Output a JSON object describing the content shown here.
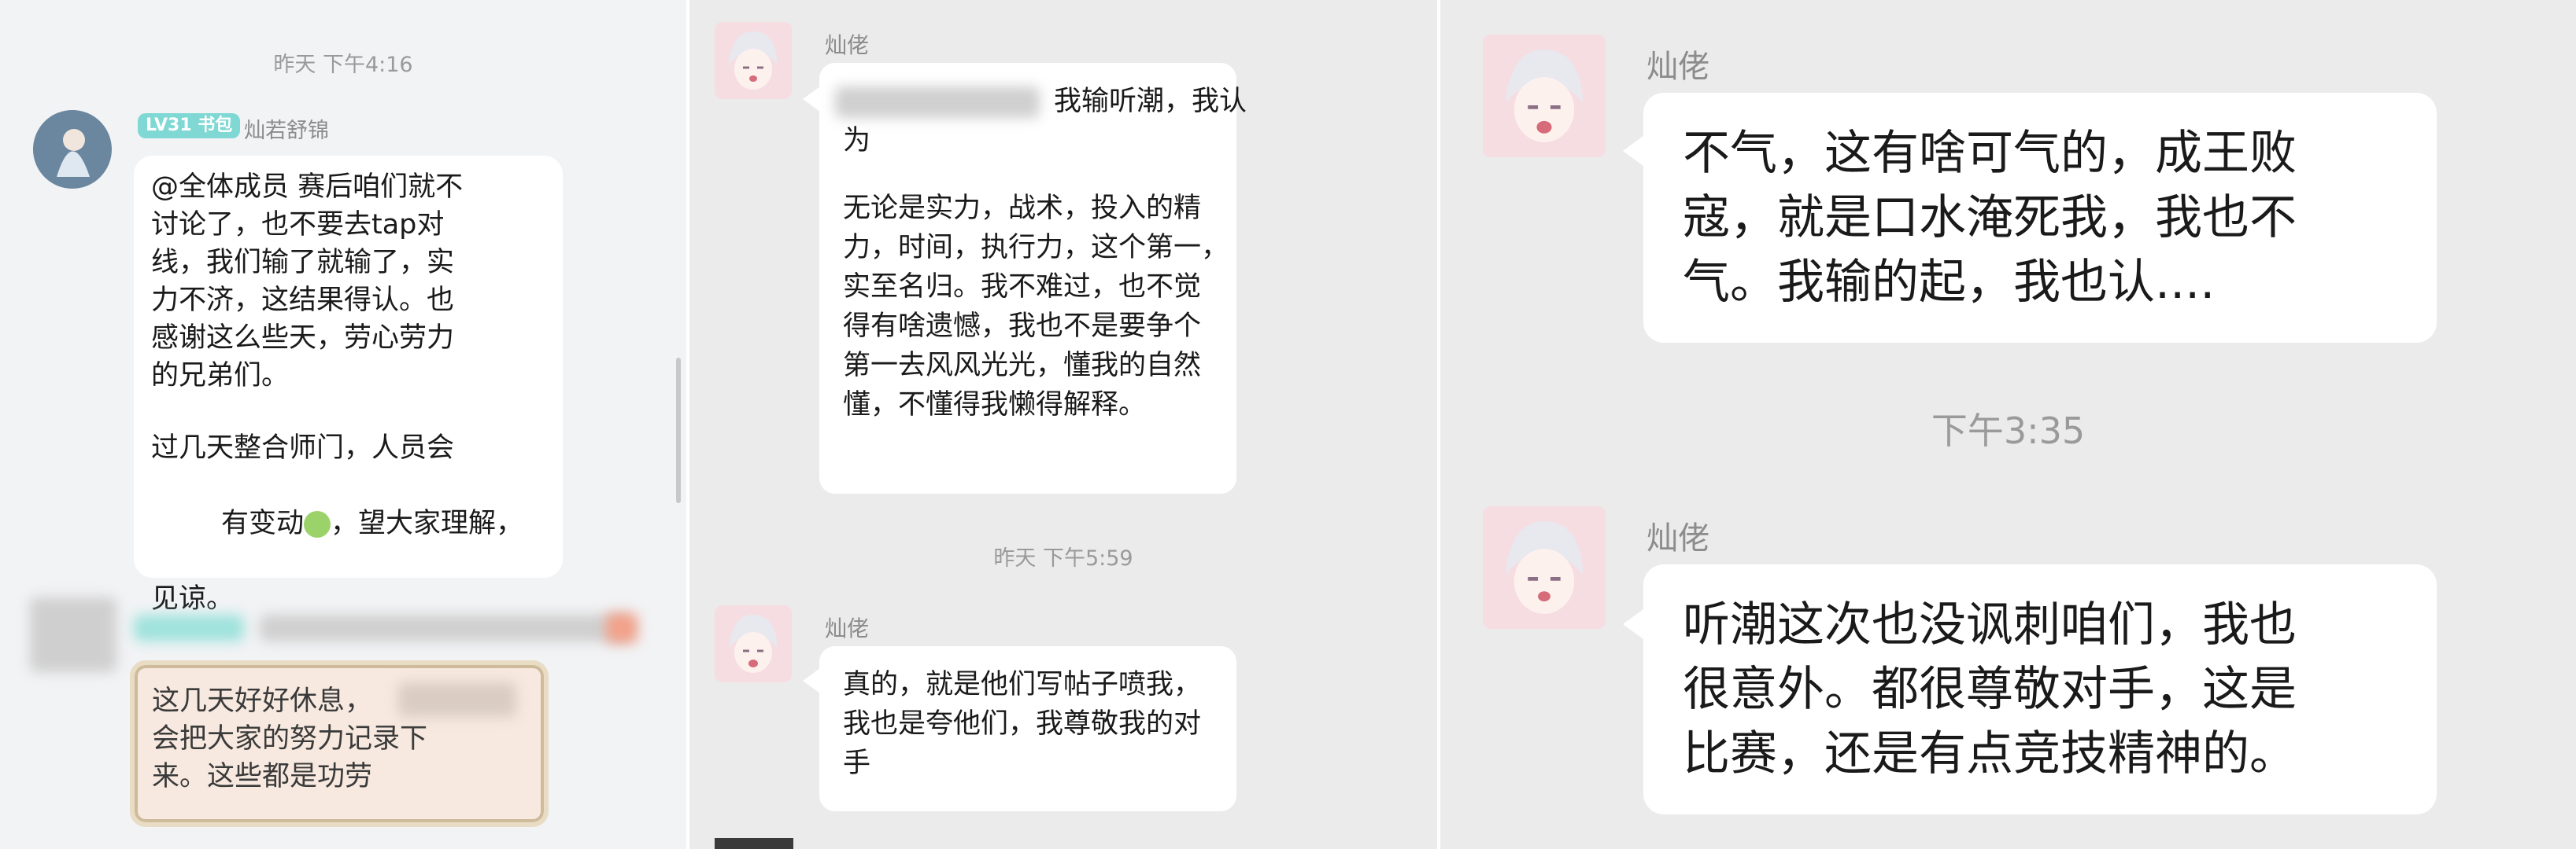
{
  "panel1": {
    "timestamp": "昨天 下午4:16",
    "badge": "LV31 书包",
    "sender": "灿若舒锦",
    "message_lines": [
      "@全体成员 赛后咱们就不",
      "讨论了，也不要去tap对",
      "线，我们输了就输了，实",
      "力不济，这结果得认。也",
      "感谢这么些天，劳心劳力",
      "的兄弟们。",
      "",
      "过几天整合师门，人员会",
      "有变动",
      "，望大家理解，",
      "见谅。"
    ],
    "reply_lines": [
      "这几天好好休息，",
      "会把大家的努力记录下",
      "来。这些都是功劳"
    ]
  },
  "panel2": {
    "sender": "灿佬",
    "message1_first": "我输听潮，我认",
    "message1_lines": [
      "为",
      "",
      "无论是实力，战术，投入的精",
      "力，时间，执行力，这个第一，",
      "实至名归。我不难过，也不觉",
      "得有啥遗憾，我也不是要争个",
      "第一去风风光光，懂我的自然",
      "懂，不懂得我懒得解释。"
    ],
    "timestamp": "昨天 下午5:59",
    "sender2": "灿佬",
    "message2_lines": [
      "真的，就是他们写帖子喷我，",
      "我也是夸他们，我尊敬我的对",
      "手"
    ]
  },
  "panel3": {
    "sender": "灿佬",
    "message1_lines": [
      "不气，这有啥可气的，成王败",
      "寇，就是口水淹死我，我也不",
      "气。我输的起，我也认...."
    ],
    "timestamp": "下午3:35",
    "sender2": "灿佬",
    "message2_lines": [
      "听潮这次也没讽刺咱们，我也",
      "很意外。都很尊敬对手，这是",
      "比赛，还是有点竞技精神的。"
    ]
  },
  "colors": {
    "panel_bg": "#ebebeb",
    "bubble_bg": "#ffffff",
    "badge_bg": "#7fd8d3",
    "avatar_bg": "#f6dde2"
  },
  "icons": [
    "avatar-knight-icon",
    "avatar-anime-icon",
    "emoji-icon"
  ]
}
